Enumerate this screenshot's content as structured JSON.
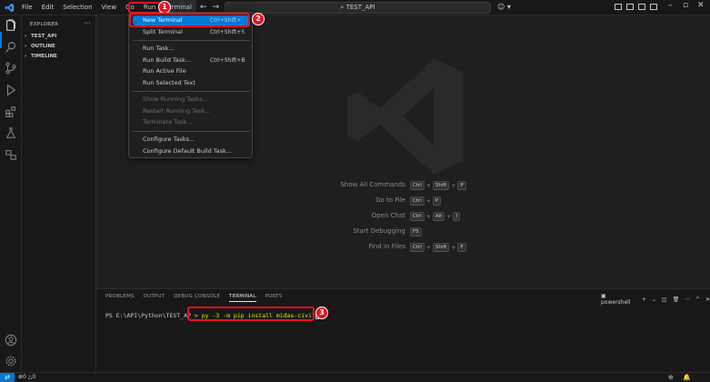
{
  "menu": [
    "File",
    "Edit",
    "Selection",
    "View",
    "Go",
    "Run",
    "Terminal"
  ],
  "search": {
    "text": "TEST_API"
  },
  "sidebar": {
    "title": "EXPLORER",
    "sections": [
      "TEST_API",
      "OUTLINE",
      "TIMELINE"
    ]
  },
  "dropdown": {
    "items": [
      {
        "label": "New Terminal",
        "shortcut": "Ctrl+Shift+`",
        "state": "highlight"
      },
      {
        "label": "Split Terminal",
        "shortcut": "Ctrl+Shift+5",
        "state": "normal"
      },
      {
        "label": "Run Task...",
        "shortcut": "",
        "state": "normal"
      },
      {
        "label": "Run Build Task...",
        "shortcut": "Ctrl+Shift+B",
        "state": "normal"
      },
      {
        "label": "Run Active File",
        "shortcut": "",
        "state": "normal"
      },
      {
        "label": "Run Selected Text",
        "shortcut": "",
        "state": "normal"
      },
      {
        "label": "Show Running Tasks...",
        "shortcut": "",
        "state": "disabled"
      },
      {
        "label": "Restart Running Task...",
        "shortcut": "",
        "state": "disabled"
      },
      {
        "label": "Terminate Task...",
        "shortcut": "",
        "state": "disabled"
      },
      {
        "label": "Configure Tasks...",
        "shortcut": "",
        "state": "normal"
      },
      {
        "label": "Configure Default Build Task...",
        "shortcut": "",
        "state": "normal"
      }
    ]
  },
  "shortcuts": [
    {
      "label": "Show All Commands",
      "keys": [
        "Ctrl",
        "Shift",
        "P"
      ]
    },
    {
      "label": "Go to File",
      "keys": [
        "Ctrl",
        "P"
      ]
    },
    {
      "label": "Open Chat",
      "keys": [
        "Ctrl",
        "Alt",
        "I"
      ]
    },
    {
      "label": "Start Debugging",
      "keys": [
        "F5"
      ]
    },
    {
      "label": "Find in Files",
      "keys": [
        "Ctrl",
        "Shift",
        "F"
      ]
    }
  ],
  "panel": {
    "tabs": [
      "PROBLEMS",
      "OUTPUT",
      "DEBUG CONSOLE",
      "TERMINAL",
      "PORTS"
    ],
    "active_tab": "TERMINAL",
    "shell": "powershell",
    "prompt": "PS E:\\API\\Python\\TEST_AP",
    "command": "py -3 -m pip install midas-civil"
  },
  "badges": [
    "1",
    "2",
    "3"
  ],
  "status": {
    "errors": "0",
    "warnings": "0"
  },
  "colors": {
    "accent": "#0078d4",
    "annotation": "#e81123"
  }
}
